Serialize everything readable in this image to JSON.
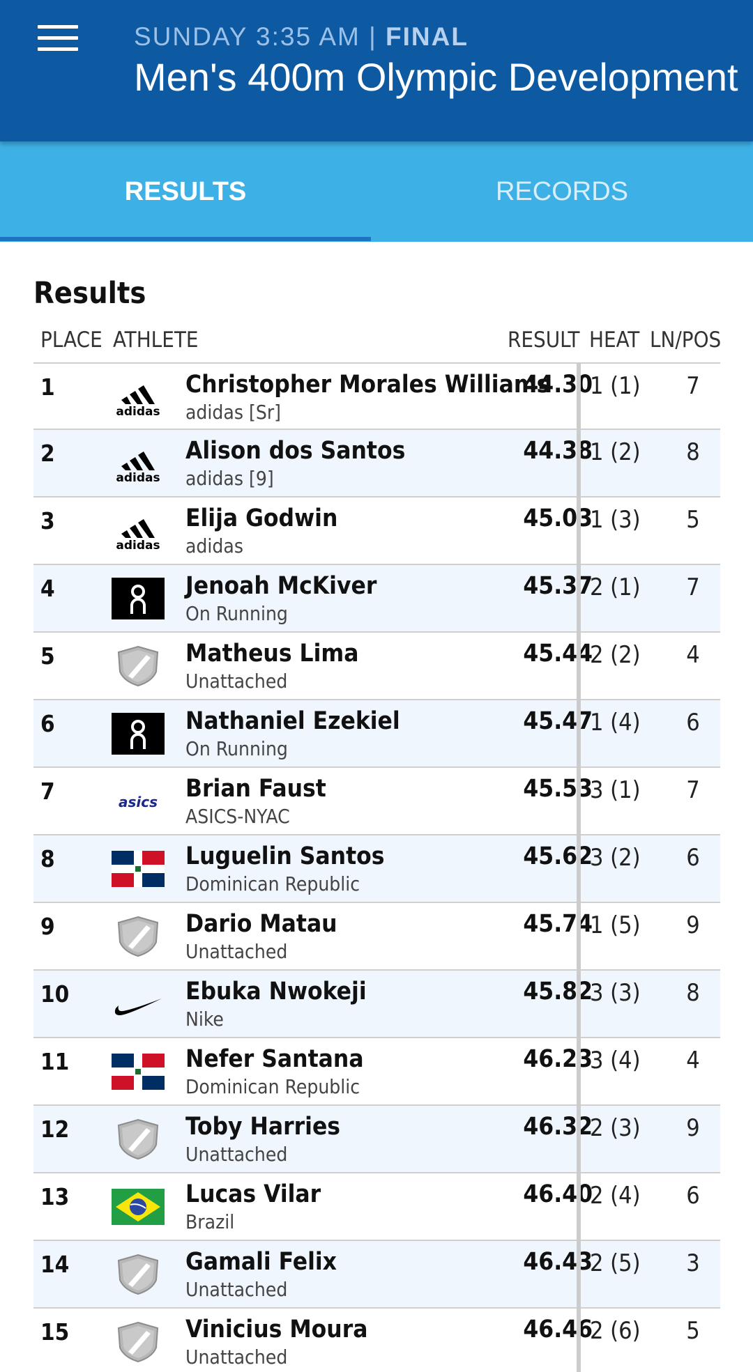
{
  "header": {
    "day_time": "SUNDAY 3:35 AM",
    "separator": " | ",
    "status": "FINAL",
    "title": "Men's 400m Olympic Development"
  },
  "tabs": [
    {
      "label": "RESULTS",
      "active": true
    },
    {
      "label": "RECORDS",
      "active": false
    }
  ],
  "section_title": "Results",
  "columns": {
    "place": "PLACE",
    "athlete": "ATHLETE",
    "result": "RESULT",
    "heat": "HEAT",
    "lnpos": "LN/POS"
  },
  "rows": [
    {
      "place": "1",
      "logo": "adidas-logo-icon",
      "name": "Christopher Morales Williams",
      "team": "adidas [Sr]",
      "result": "44.30",
      "heat": "1 (1)",
      "lnpos": "7"
    },
    {
      "place": "2",
      "logo": "adidas-logo-icon",
      "name": "Alison dos Santos",
      "team": "adidas [9]",
      "result": "44.38",
      "heat": "1 (2)",
      "lnpos": "8"
    },
    {
      "place": "3",
      "logo": "adidas-logo-icon",
      "name": "Elija Godwin",
      "team": "adidas",
      "result": "45.03",
      "heat": "1 (3)",
      "lnpos": "5"
    },
    {
      "place": "4",
      "logo": "on-running-logo-icon",
      "name": "Jenoah McKiver",
      "team": "On Running",
      "result": "45.37",
      "heat": "2 (1)",
      "lnpos": "7"
    },
    {
      "place": "5",
      "logo": "unattached-shield-icon",
      "name": "Matheus Lima",
      "team": "Unattached",
      "result": "45.44",
      "heat": "2 (2)",
      "lnpos": "4"
    },
    {
      "place": "6",
      "logo": "on-running-logo-icon",
      "name": "Nathaniel Ezekiel",
      "team": "On Running",
      "result": "45.47",
      "heat": "1 (4)",
      "lnpos": "6"
    },
    {
      "place": "7",
      "logo": "asics-logo-icon",
      "name": "Brian Faust",
      "team": "ASICS-NYAC",
      "result": "45.53",
      "heat": "3 (1)",
      "lnpos": "7"
    },
    {
      "place": "8",
      "logo": "dominican-flag-icon",
      "name": "Luguelin Santos",
      "team": "Dominican Republic",
      "result": "45.62",
      "heat": "3 (2)",
      "lnpos": "6"
    },
    {
      "place": "9",
      "logo": "unattached-shield-icon",
      "name": "Dario Matau",
      "team": "Unattached",
      "result": "45.74",
      "heat": "1 (5)",
      "lnpos": "9"
    },
    {
      "place": "10",
      "logo": "nike-swoosh-icon",
      "name": "Ebuka Nwokeji",
      "team": "Nike",
      "result": "45.82",
      "heat": "3 (3)",
      "lnpos": "8"
    },
    {
      "place": "11",
      "logo": "dominican-flag-icon",
      "name": "Nefer Santana",
      "team": "Dominican Republic",
      "result": "46.23",
      "heat": "3 (4)",
      "lnpos": "4"
    },
    {
      "place": "12",
      "logo": "unattached-shield-icon",
      "name": "Toby Harries",
      "team": "Unattached",
      "result": "46.32",
      "heat": "2 (3)",
      "lnpos": "9"
    },
    {
      "place": "13",
      "logo": "brazil-flag-icon",
      "name": "Lucas Vilar",
      "team": "Brazil",
      "result": "46.40",
      "heat": "2 (4)",
      "lnpos": "6"
    },
    {
      "place": "14",
      "logo": "unattached-shield-icon",
      "name": "Gamali Felix",
      "team": "Unattached",
      "result": "46.43",
      "heat": "2 (5)",
      "lnpos": "3"
    },
    {
      "place": "15",
      "logo": "unattached-shield-icon",
      "name": "Vinicius Moura",
      "team": "Unattached",
      "result": "46.46",
      "heat": "2 (6)",
      "lnpos": "5"
    }
  ],
  "colors": {
    "header_bg": "#0d5aa3",
    "tab_bar_bg": "#3db1e6",
    "active_tab_indicator": "#1e74c3",
    "alt_row_bg": "#f0f6fd"
  }
}
